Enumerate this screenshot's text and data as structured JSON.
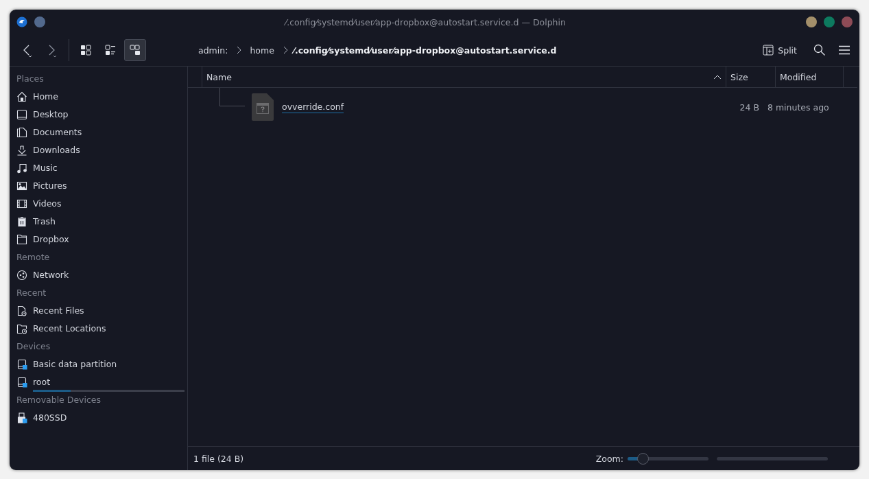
{
  "window": {
    "title": "⁄.config⁄systemd⁄user⁄app-dropbox@autostart.service.d — Dolphin"
  },
  "toolbar": {
    "view_modes": [
      {
        "selected": false
      },
      {
        "selected": false
      },
      {
        "selected": true
      }
    ],
    "split": "Split"
  },
  "breadcrumb": [
    {
      "label": "admin:",
      "current": false
    },
    {
      "label": "home",
      "current": false
    },
    {
      "label": "⁄.config⁄systemd⁄user⁄app-dropbox@autostart.service.d",
      "current": true
    }
  ],
  "sidebar": {
    "sections": [
      {
        "title": "Places",
        "items": [
          {
            "label": "Home"
          },
          {
            "label": "Desktop"
          },
          {
            "label": "Documents"
          },
          {
            "label": "Downloads"
          },
          {
            "label": "Music"
          },
          {
            "label": "Pictures"
          },
          {
            "label": "Videos"
          },
          {
            "label": "Trash"
          },
          {
            "label": "Dropbox"
          }
        ]
      },
      {
        "title": "Remote",
        "items": [
          {
            "label": "Network"
          }
        ]
      },
      {
        "title": "Recent",
        "items": [
          {
            "label": "Recent Files"
          },
          {
            "label": "Recent Locations"
          }
        ]
      },
      {
        "title": "Devices",
        "items": [
          {
            "label": "Basic data partition"
          },
          {
            "label": "root",
            "level": 0.25
          }
        ]
      },
      {
        "title": "Removable Devices",
        "items": [
          {
            "label": "480SSD"
          }
        ]
      }
    ]
  },
  "table": {
    "columns": [
      "Name",
      "Size",
      "Modified"
    ],
    "rows": [
      {
        "name": "ovverride.conf",
        "size": "24 B",
        "modified": "8 minutes ago"
      }
    ]
  },
  "status_bar": {
    "text": "1 file (24 B)",
    "zoom_label": "Zoom:",
    "zoom": {
      "level": 0.15
    }
  }
}
